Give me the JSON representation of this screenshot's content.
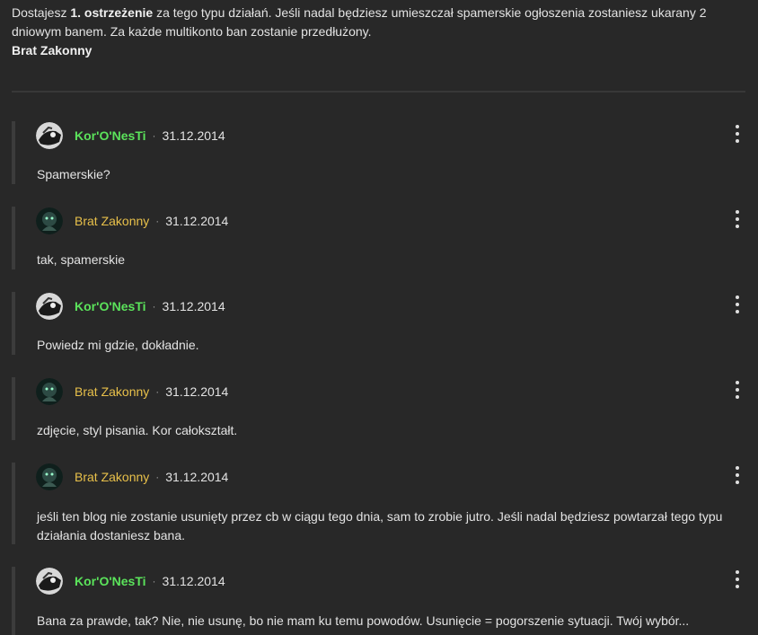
{
  "top_message": {
    "part1": "Dostajesz ",
    "bold": "1. ostrzeżenie",
    "part2": " za tego typu działań. Jeśli nadal będziesz umieszczał spamerskie ogłoszenia zostaniesz ukarany 2 dniowym banem. Za każde multikonto ban zostanie przedłużony.",
    "signature": "Brat Zakonny"
  },
  "comments": [
    {
      "author": "Kor'O'NesTi",
      "separator": "·",
      "date": "31.12.2014",
      "text": "Spamerskie?"
    },
    {
      "author": "Brat Zakonny",
      "separator": "·",
      "date": "31.12.2014",
      "text": "tak, spamerskie"
    },
    {
      "author": "Kor'O'NesTi",
      "separator": "·",
      "date": "31.12.2014",
      "text": "Powiedz mi gdzie, dokładnie."
    },
    {
      "author": "Brat Zakonny",
      "separator": "·",
      "date": "31.12.2014",
      "text": "zdjęcie, styl pisania. Kor całokształt."
    },
    {
      "author": "Brat Zakonny",
      "separator": "·",
      "date": "31.12.2014",
      "text": "jeśli ten blog nie zostanie usunięty przez cb w ciągu tego dnia, sam to zrobie jutro. Jeśli nadal będziesz powtarzał tego typu działania dostaniesz bana."
    },
    {
      "author": "Kor'O'NesTi",
      "separator": "·",
      "date": "31.12.2014",
      "text": "Bana za prawde, tak? Nie, nie usunę, bo nie mam ku temu powodów. Usunięcie = pogorszenie sytuacji. Twój wybór..."
    }
  ],
  "colors": {
    "background": "#282828",
    "author_kor": "#5be35b",
    "author_brat": "#e8c04a",
    "thread_bar": "#3c3c3c"
  },
  "icons": {
    "menu": "more-vertical-icon",
    "avatar_kor": "avatar-image",
    "avatar_brat": "avatar-image"
  }
}
